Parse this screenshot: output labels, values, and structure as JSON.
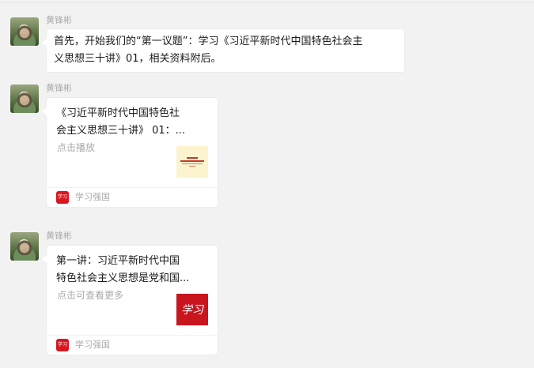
{
  "messages": [
    {
      "sender": "黄锋彬",
      "text_line1": "首先，开始我们的“第一议题”：学习《习近平新时代中国特色社会主",
      "text_line2": "义思想三十讲》01，相关资料附后。"
    },
    {
      "sender": "黄锋彬",
      "card": {
        "title_line1": "《习近平新时代中国特色社",
        "title_line2": "会主义思想三十讲》 01：...",
        "subtitle": "点击播放",
        "thumb": "book-cover-thumbnail",
        "thumb_text": "",
        "app_icon_text": "学习",
        "app_name": "学习强国"
      }
    },
    {
      "sender": "黄锋彬",
      "card": {
        "title_line1": "第一讲：习近平新时代中国",
        "title_line2": "特色社会主义思想是党和国...",
        "subtitle": "点击可查看更多",
        "thumb": "xuexi-logo-thumbnail",
        "thumb_text": "学习",
        "app_icon_text": "学习",
        "app_name": "学习强国"
      }
    }
  ],
  "colors": {
    "background": "#f2f2f2",
    "bubble": "#ffffff",
    "sender": "#aaaaaa",
    "brand_red": "#d7171f"
  }
}
